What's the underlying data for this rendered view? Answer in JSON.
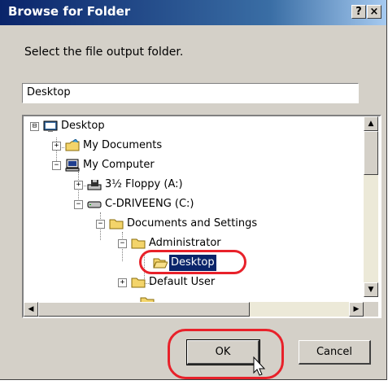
{
  "window": {
    "title": "Browse for Folder",
    "help_label": "?",
    "close_label": "×"
  },
  "prompt": "Select the file output folder.",
  "path_field": {
    "value": "Desktop"
  },
  "tree": {
    "nodes": [
      {
        "label": "Desktop",
        "icon": "desktop-icon",
        "expander": "⊟"
      },
      {
        "label": "My Documents",
        "icon": "my-documents-icon",
        "expander": "+"
      },
      {
        "label": "My Computer",
        "icon": "my-computer-icon",
        "expander": "−"
      },
      {
        "label": "3½ Floppy (A:)",
        "icon": "floppy-drive-icon",
        "expander": "+"
      },
      {
        "label": "C-DRIVEENG (C:)",
        "icon": "hard-drive-icon",
        "expander": "−"
      },
      {
        "label": "Documents and Settings",
        "icon": "folder-icon",
        "expander": "−"
      },
      {
        "label": "Administrator",
        "icon": "folder-icon",
        "expander": "−"
      },
      {
        "label": "Desktop",
        "icon": "open-folder-icon",
        "expander": "",
        "selected": true
      },
      {
        "label": "Default User",
        "icon": "folder-icon",
        "expander": "+"
      }
    ]
  },
  "buttons": {
    "ok": "OK",
    "cancel": "Cancel"
  },
  "colors": {
    "titlebar": "#0a246a",
    "highlight": "#e8212a",
    "face": "#d4d0c8",
    "selection": "#0a246a"
  }
}
